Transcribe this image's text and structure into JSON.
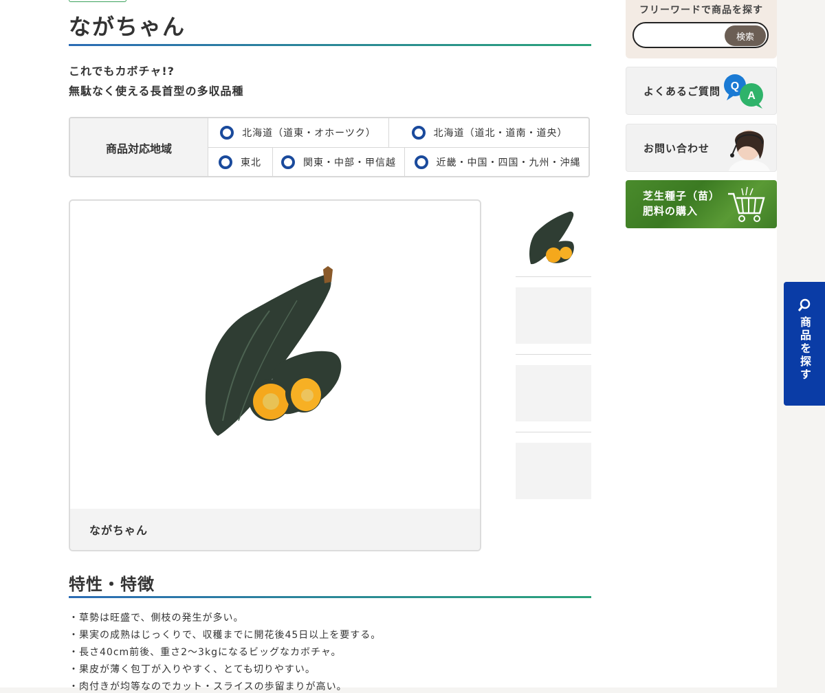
{
  "product": {
    "title": "ながちゃん",
    "lead1": "これでもカボチャ!?",
    "lead2": "無駄なく使える長首型の多収品種"
  },
  "region": {
    "heading": "商品対応地域",
    "row1": [
      "北海道（道東・オホーツク）",
      "北海道（道北・道南・道央）"
    ],
    "row2": [
      "東北",
      "関東・中部・甲信越",
      "近畿・中国・四国・九州・沖縄"
    ]
  },
  "gallery": {
    "caption": "ながちゃん"
  },
  "features": {
    "title": "特性・特徴",
    "items": [
      "・草勢は旺盛で、側枝の発生が多い。",
      "・果実の成熟はじっくりで、収穫までに開花後45日以上を要する。",
      "・長さ40cm前後、重さ2〜3kgになるビッグなカボチャ。",
      "・果皮が薄く包丁が入りやすく、とても切りやすい。",
      "・肉付きが均等なのでカット・スライスの歩留まりが高い。"
    ]
  },
  "sidebar": {
    "search_label": "フリーワードで商品を探す",
    "search_placeholder": "",
    "search_button": "検索",
    "faq": "よくあるご質問",
    "contact": "お問い合わせ",
    "buy_line1": "芝生種子（苗）",
    "buy_line2": "肥料の購入",
    "q_letter": "Q",
    "a_letter": "A"
  },
  "float_tab": {
    "label": "商品を探す"
  },
  "colors": {
    "accent_blue": "#1a4a9c",
    "float_tab": "#0a3ca6",
    "rule_start": "#2b6cb5",
    "rule_end": "#2aa37a"
  }
}
